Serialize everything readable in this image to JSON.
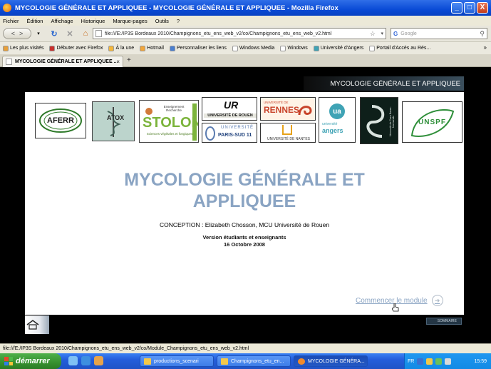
{
  "window": {
    "title": "MYCOLOGIE GÉNÉRALE ET APPLIQUEE - MYCOLOGIE GÉNÉRALE ET APPLIQUEE - Mozilla Firefox",
    "buttons": [
      "_",
      "□",
      "X"
    ]
  },
  "menu": [
    "Fichier",
    "Édition",
    "Affichage",
    "Historique",
    "Marque-pages",
    "Outils",
    "?"
  ],
  "nav": {
    "url": "file:///E:/IP3S Bordeaux 2010/Champignons_etu_ens_web_v2/co/Champignons_etu_ens_web_v2.html",
    "search_placeholder": "Google"
  },
  "bookmarks": [
    {
      "label": "Les plus visités",
      "color": "#e8a03a"
    },
    {
      "label": "Débuter avec Firefox",
      "color": "#c8302c"
    },
    {
      "label": "À la une",
      "color": "#f4b73b"
    },
    {
      "label": "Hotmail",
      "color": "#f2a63b"
    },
    {
      "label": "Personnaliser les liens",
      "color": "#4a7fd0"
    },
    {
      "label": "Windows Media",
      "color": "#ffffff"
    },
    {
      "label": "Windows",
      "color": "#ffffff"
    },
    {
      "label": "Université d'Angers",
      "color": "#3fa3b5"
    },
    {
      "label": "Portail d'Accès au Rés...",
      "color": "#ffffff"
    }
  ],
  "tab": {
    "label": "MYCOLOGIE GÉNÉRALE ET APPLIQUEE ..."
  },
  "content": {
    "header": "MYCOLOGIE GÉNÉRALE ET APPLIQUEE",
    "logos": {
      "aferr": "AFERR",
      "atox": "ATOX",
      "stolon_sub": "Enseignement Recherche",
      "stolon": "STOLON",
      "stolon_caption": "Sciences végétales et fongiques",
      "rouen_abbr": "UR",
      "rouen": "UNIVERSITÉ DE ROUEN",
      "rennes": "RENNES",
      "rennes_top": "UNIVERSITÉ DE",
      "paris_top": "UNIVERSITÉ",
      "paris": "PARIS-SUD 11",
      "nantes": "UNIVERSITÉ DE NANTES",
      "angers_ua": "ua",
      "angers_sub": "université",
      "angers": "angers",
      "caen": "Université de Caen Basse-Normandie",
      "unspf": "UNSPF"
    },
    "title_line1": "MYCOLOGIE GÉNÉRALE ET",
    "title_line2": "APPLIQUEE",
    "conception": "CONCEPTION : Elizabeth Chosson, MCU Université de Rouen",
    "version": "Version étudiants et enseignants",
    "date": "16 Octobre 2008",
    "begin_label": "Commencer le module",
    "sommaire": "SOMMAIRE"
  },
  "status": "file:///E:/IP3S Bordeaux 2010/Champignons_etu_ens_web_v2/co/Module_Champignons_etu_ens_web_v2.html",
  "taskbar": {
    "start": "démarrer",
    "tasks": [
      "productions_scenari",
      "Champignons_etu_en...",
      "MYCOLOGIE GÉNÉRA..."
    ],
    "lang": "FR",
    "clock": "15:59"
  }
}
